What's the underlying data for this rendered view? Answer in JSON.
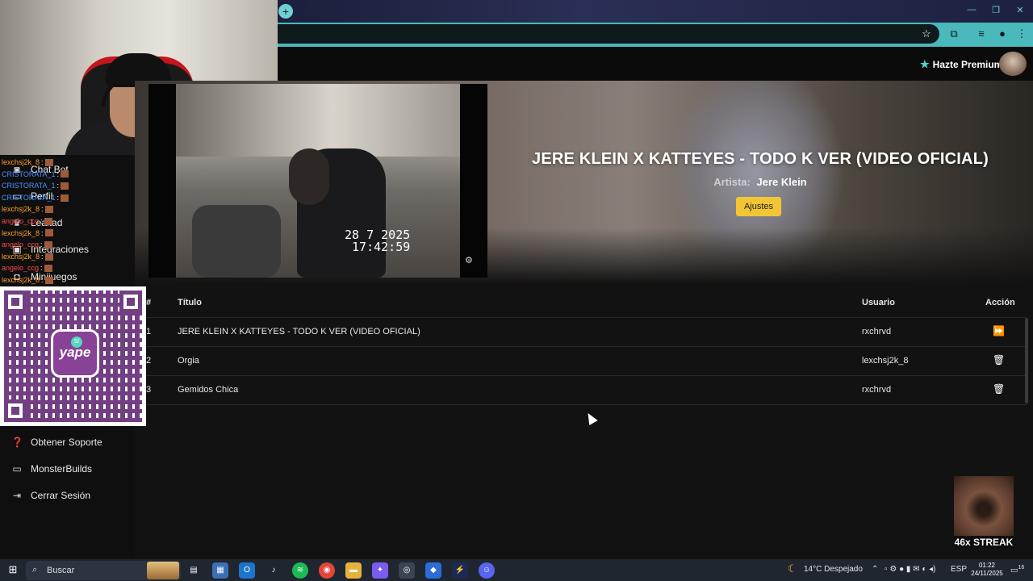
{
  "browser": {
    "new_tab_icon": "plus-icon",
    "window_controls": [
      "minimize-icon",
      "maximize-icon",
      "close-icon"
    ],
    "toolbar_icons": [
      "star-icon",
      "extensions-icon",
      "media-icon",
      "profile-icon",
      "menu-icon"
    ]
  },
  "header": {
    "premium_label": "Hazte Premium",
    "premium_icon": "star-icon",
    "avatar": "user-avatar"
  },
  "hero": {
    "title": "JERE KLEIN X KATTEYES - TODO K VER (VIDEO OFICIAL)",
    "artist_label": "Artista:",
    "artist": "Jere Klein",
    "settings_button": "Ajustes",
    "video_timestamp_date": "28  7 2025",
    "video_timestamp_time": "17:42:59"
  },
  "table": {
    "headers": {
      "num": "#",
      "title": "Título",
      "user": "Usuario",
      "action": "Acción"
    },
    "rows": [
      {
        "num": "1",
        "title": "JERE KLEIN X KATTEYES - TODO K VER (VIDEO OFICIAL)",
        "user": "rxchrvd",
        "action_icon": "skip-forward-icon"
      },
      {
        "num": "2",
        "title": "Orgia",
        "user": "lexchsj2k_8",
        "action_icon": "trash-icon"
      },
      {
        "num": "3",
        "title": "Gemidos Chica",
        "user": "rxchrvd",
        "action_icon": "trash-icon"
      }
    ]
  },
  "sidebar": {
    "items_top": [
      {
        "label": "Chat Bot",
        "icon": "robot-icon"
      },
      {
        "label": "Perfil",
        "icon": "user-icon"
      },
      {
        "label": "Lealtad",
        "icon": "trophy-icon"
      },
      {
        "label": "Integraciones",
        "icon": "plug-icon"
      },
      {
        "label": "Minijuegos",
        "icon": "gamepad-icon"
      }
    ],
    "items_bottom": [
      {
        "label": "Obtener Soporte",
        "icon": "help-icon"
      },
      {
        "label": "MonsterBuilds",
        "icon": "laptop-icon"
      },
      {
        "label": "Cerrar Sesión",
        "icon": "logout-icon"
      }
    ]
  },
  "chat": [
    {
      "user": "lexchsj2k_8",
      "sep": ":"
    },
    {
      "user": "CRISTORATA_1",
      "sep": ":"
    },
    {
      "user": "CRISTORATA_1",
      "sep": ":"
    },
    {
      "user": "CRISTORATA_1",
      "sep": ":"
    },
    {
      "user": "lexchsj2k_8",
      "sep": ":"
    },
    {
      "user": "angelo_ccg",
      "sep": ":"
    },
    {
      "user": "lexchsj2k_8",
      "sep": ":"
    },
    {
      "user": "angelo_ccg",
      "sep": ":"
    },
    {
      "user": "lexchsj2k_8",
      "sep": ":"
    },
    {
      "user": "angelo_ccg",
      "sep": ":"
    },
    {
      "user": "lexchsj2k_8",
      "sep": ":"
    }
  ],
  "qr": {
    "brand": "yape",
    "coin": "S/"
  },
  "overlay": {
    "streak": "46x STREAK"
  },
  "taskbar": {
    "search_placeholder": "Buscar",
    "weather": "14°C  Despejado",
    "language": "ESP",
    "time": "01:22",
    "date": "24/11/2025",
    "notifications": "16"
  },
  "colors": {
    "accent_button": "#f2c534",
    "browser_accent": "#4ab9bc",
    "premium_icon": "#4ed8c8",
    "yape_purple": "#742284"
  }
}
